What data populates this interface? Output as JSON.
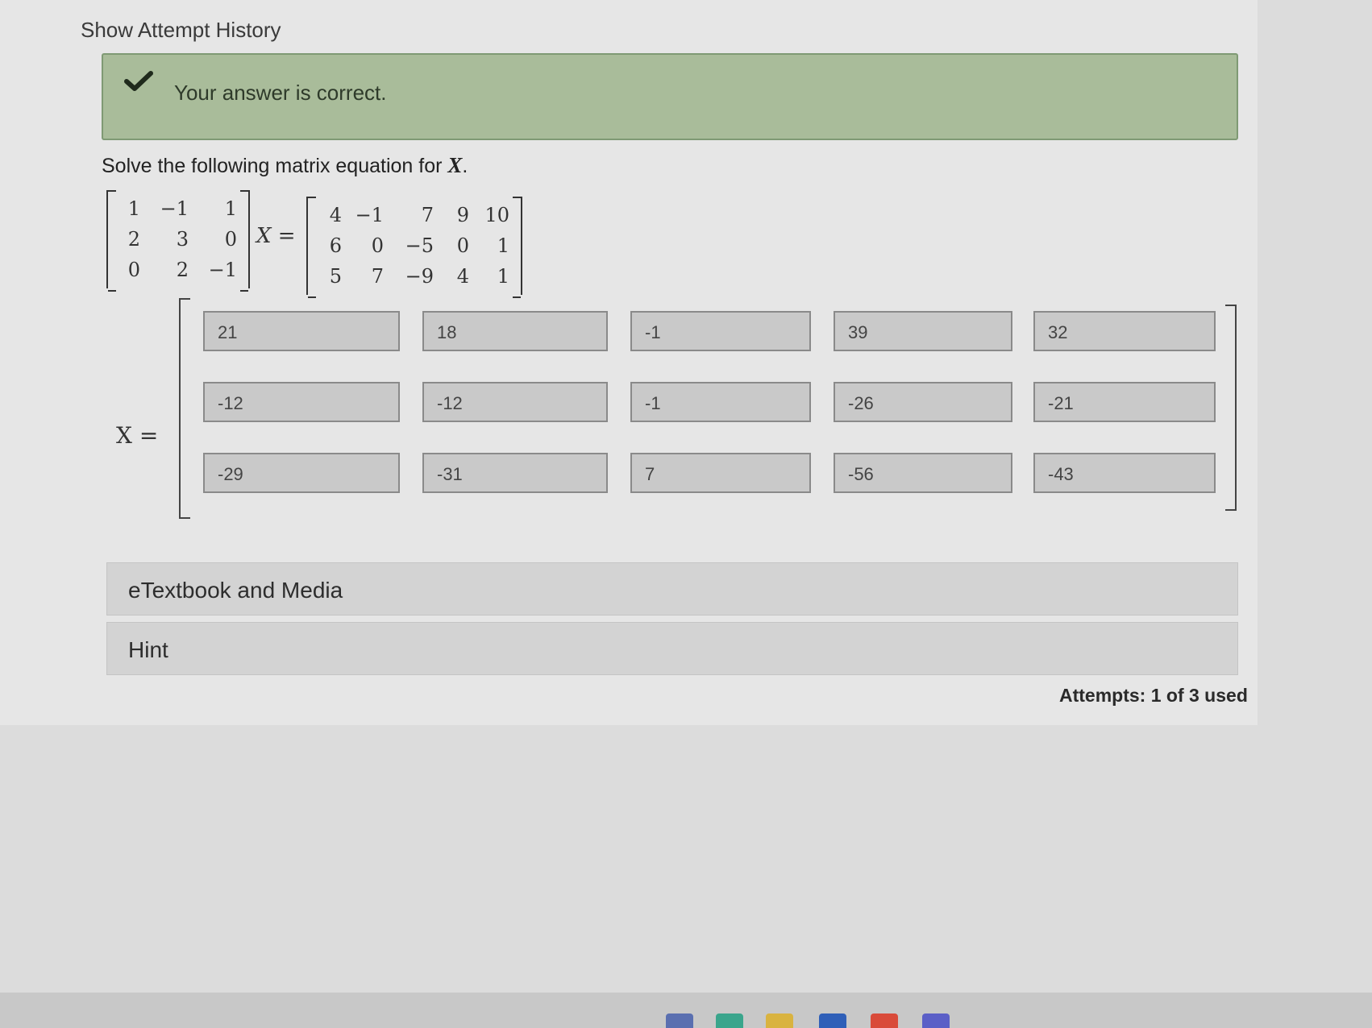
{
  "header": {
    "attempt_history_link": "Show Attempt History"
  },
  "feedback": {
    "message": "Your answer is correct.",
    "icon": "checkmark-icon"
  },
  "question": {
    "prompt": "Solve the following matrix equation for",
    "variable": "X",
    "period": ".",
    "equals_label": "X =",
    "matrix_a": [
      [
        "1",
        "−1",
        "1"
      ],
      [
        "2",
        "3",
        "0"
      ],
      [
        "0",
        "2",
        "−1"
      ]
    ],
    "matrix_b": [
      [
        "4",
        "−1",
        "7",
        "9",
        "10"
      ],
      [
        "6",
        "0",
        "−5",
        "0",
        "1"
      ],
      [
        "5",
        "7",
        "−9",
        "4",
        "1"
      ]
    ]
  },
  "answer": {
    "label": "X =",
    "rows": [
      [
        "21",
        "18",
        "-1",
        "39",
        "32"
      ],
      [
        "-12",
        "-12",
        "-1",
        "-26",
        "-21"
      ],
      [
        "-29",
        "-31",
        "7",
        "-56",
        "-43"
      ]
    ]
  },
  "sections": {
    "etextbook": "eTextbook and Media",
    "hint": "Hint"
  },
  "attempts": "Attempts: 1 of 3 used",
  "colors": {
    "feedback_bg": "#a9bc9a",
    "field_bg": "#c9c9c9"
  }
}
